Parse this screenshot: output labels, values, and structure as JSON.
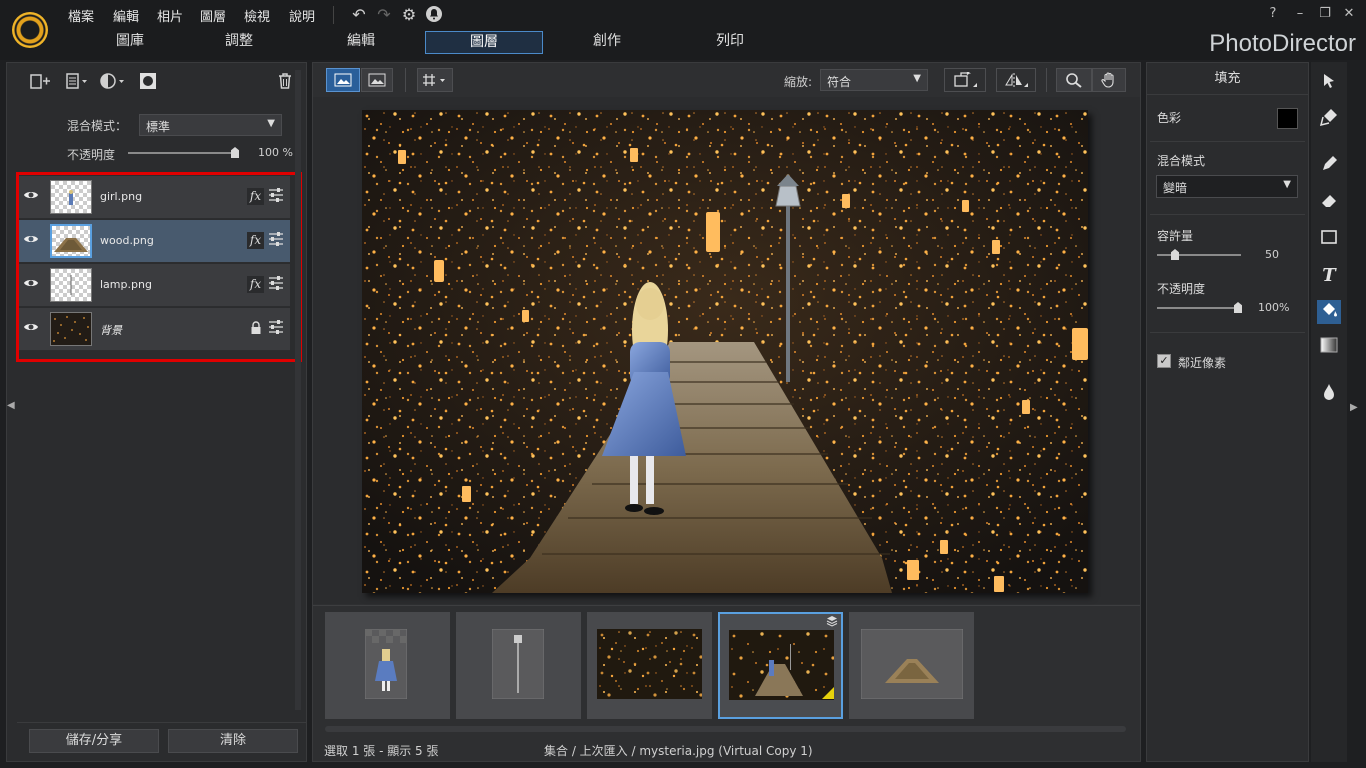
{
  "app": {
    "title": "PhotoDirector"
  },
  "menu": [
    "檔案",
    "編輯",
    "相片",
    "圖層",
    "檢視",
    "說明"
  ],
  "window_controls": [
    "?",
    "–",
    "❐",
    "✕"
  ],
  "tabs": [
    "圖庫",
    "調整",
    "編輯",
    "圖層",
    "創作",
    "列印"
  ],
  "active_tab": "圖層",
  "left_panel": {
    "blend_mode_label": "混合模式：",
    "blend_mode_value": "標準",
    "opacity_label": "不透明度",
    "opacity_value": "100 %",
    "opacity_level": 1.0,
    "layers": [
      {
        "name": "girl.png",
        "selected": false,
        "type": "fx"
      },
      {
        "name": "wood.png",
        "selected": true,
        "type": "fx"
      },
      {
        "name": "lamp.png",
        "selected": false,
        "type": "fx"
      },
      {
        "name": "背景",
        "selected": false,
        "type": "locked"
      }
    ],
    "save_share_button": "儲存/分享",
    "clear_button": "清除"
  },
  "view_toolbar": {
    "zoom_label": "縮放:",
    "zoom_value": "符合"
  },
  "filmstrip": {
    "items": [
      "girl",
      "lamp",
      "background",
      "mysteria",
      "wood"
    ],
    "selected_index": 3
  },
  "status": {
    "selection": "選取 1 張 - 顯示 5 張",
    "path": "集合 / 上次匯入 / mysteria.jpg (Virtual Copy 1)"
  },
  "right_panel": {
    "title": "填充",
    "color_label": "色彩",
    "color_value": "#000000",
    "blend_label": "混合模式",
    "blend_value": "變暗",
    "tolerance_label": "容許量",
    "tolerance_value": "50",
    "tolerance_level": 0.25,
    "opacity_label": "不透明度",
    "opacity_value": "100%",
    "opacity_level": 1.0,
    "adjacent_label": "鄰近像素",
    "adjacent_checked": true
  },
  "tools": [
    "select-arrow",
    "clone-brush",
    "pencil",
    "eraser",
    "rectangle",
    "text",
    "fill-bucket",
    "gradient",
    "blur-drop"
  ],
  "active_tool": "fill-bucket"
}
